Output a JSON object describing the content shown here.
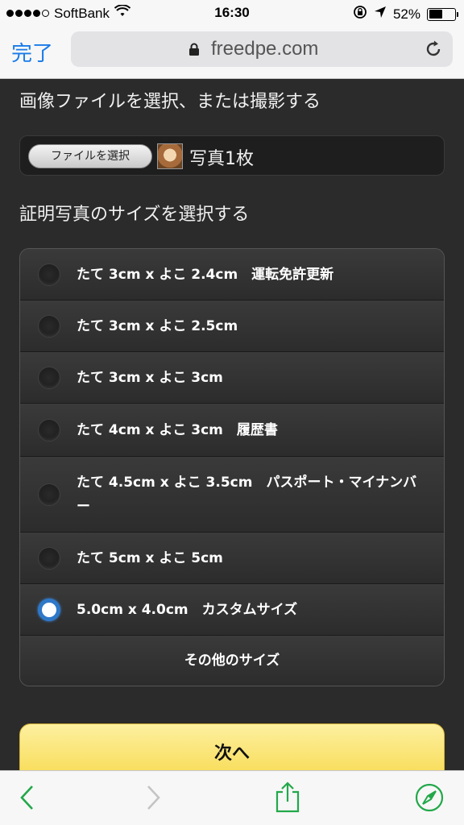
{
  "status_bar": {
    "carrier": "SoftBank",
    "time": "16:30",
    "battery": "52%",
    "battery_level": 0.52,
    "signal_bars": 4
  },
  "nav": {
    "done_label": "完了",
    "url": "freedpe.com"
  },
  "page": {
    "select_heading": "画像ファイルを選択、または撮影する",
    "file_button": "ファイルを選択",
    "photo_count": "写真1枚",
    "size_heading": "証明写真のサイズを選択する",
    "size_options": [
      {
        "label": "たて 3cm x よこ 2.4cm　運転免許更新",
        "selected": false
      },
      {
        "label": "たて 3cm x よこ 2.5cm",
        "selected": false
      },
      {
        "label": "たて 3cm x よこ 3cm",
        "selected": false
      },
      {
        "label": "たて 4cm x よこ 3cm　履歴書",
        "selected": false
      },
      {
        "label": "たて 4.5cm x よこ 3.5cm　パスポート・マイナンバー",
        "selected": false
      },
      {
        "label": "たて 5cm x よこ 5cm",
        "selected": false
      },
      {
        "label": "5.0cm x 4.0cm　カスタムサイズ",
        "selected": true
      }
    ],
    "other_sizes": "その他のサイズ",
    "next_button": "次へ"
  },
  "colors": {
    "accent": "#1a7be8",
    "radio_selected": "#2f78c8",
    "next_button": "#f7d94c",
    "toolbar_icon": "#22a84a"
  },
  "icons": {
    "wifi": "wifi-icon",
    "rotation_lock": "rotation-lock-icon",
    "location": "location-arrow-icon",
    "lock": "lock-icon",
    "reload": "reload-icon",
    "back": "chevron-left-icon",
    "forward": "chevron-right-icon",
    "share": "share-icon",
    "safari": "compass-icon"
  }
}
